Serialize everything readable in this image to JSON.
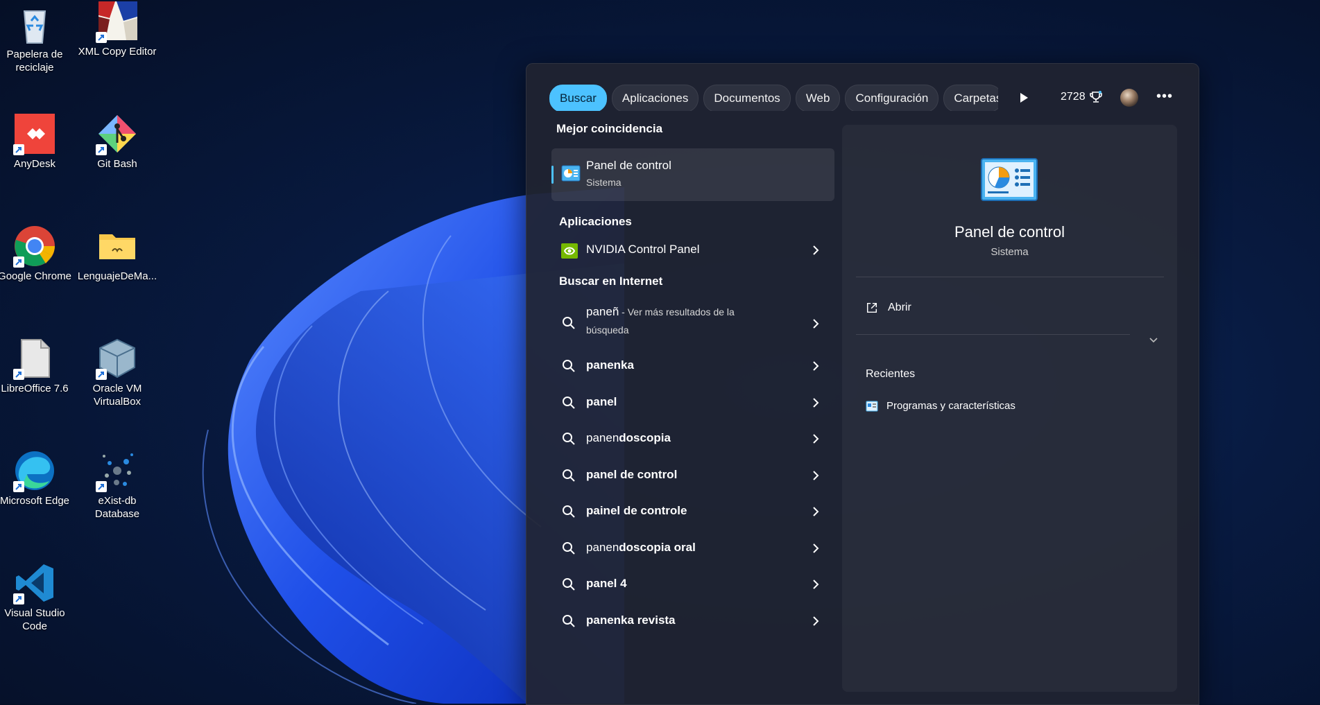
{
  "desktop": {
    "icons": [
      {
        "label": "Papelera de reciclaje",
        "icon": "recycle-bin-icon"
      },
      {
        "label": "XML Copy Editor",
        "icon": "xml-copy-editor-icon"
      },
      {
        "label": "AnyDesk",
        "icon": "anydesk-icon"
      },
      {
        "label": "Git Bash",
        "icon": "git-bash-icon"
      },
      {
        "label": "Google Chrome",
        "icon": "chrome-icon"
      },
      {
        "label": "LenguajeDeMa...",
        "icon": "folder-icon"
      },
      {
        "label": "LibreOffice 7.6",
        "icon": "libreoffice-icon"
      },
      {
        "label": "Oracle VM VirtualBox",
        "icon": "virtualbox-icon"
      },
      {
        "label": "Microsoft Edge",
        "icon": "edge-icon"
      },
      {
        "label": "eXist-db Database",
        "icon": "exist-db-icon"
      },
      {
        "label": "Visual Studio Code",
        "icon": "vscode-icon"
      }
    ]
  },
  "search": {
    "tabs": [
      {
        "label": "Buscar",
        "active": true
      },
      {
        "label": "Aplicaciones"
      },
      {
        "label": "Documentos"
      },
      {
        "label": "Web"
      },
      {
        "label": "Configuración"
      },
      {
        "label": "Carpetas"
      }
    ],
    "points": "2728",
    "best_match": {
      "heading": "Mejor coincidencia",
      "title": "Panel de control",
      "subtitle": "Sistema"
    },
    "apps": {
      "heading": "Aplicaciones",
      "items": [
        {
          "label": "NVIDIA Control Panel"
        }
      ]
    },
    "web": {
      "heading": "Buscar en Internet",
      "first": {
        "query": "paneñ",
        "suffix": " - Ver más resultados de la búsqueda"
      },
      "items": [
        {
          "prefix": "panenka",
          "rest": ""
        },
        {
          "prefix": "panel",
          "rest": ""
        },
        {
          "prefix": "panen",
          "rest": "doscopia"
        },
        {
          "prefix": "panel de control",
          "rest": ""
        },
        {
          "prefix": "painel de controle",
          "rest": ""
        },
        {
          "prefix": "panen",
          "rest": "doscopia oral"
        },
        {
          "prefix": "panel 4",
          "rest": ""
        },
        {
          "prefix": "panenka revista",
          "rest": ""
        }
      ]
    },
    "details": {
      "title": "Panel de control",
      "subtitle": "Sistema",
      "open_label": "Abrir",
      "recent_heading": "Recientes",
      "recent_items": [
        {
          "label": "Programas y características"
        }
      ]
    }
  },
  "colors": {
    "accent": "#4cc2ff",
    "tab_active_text": "#05243a"
  }
}
